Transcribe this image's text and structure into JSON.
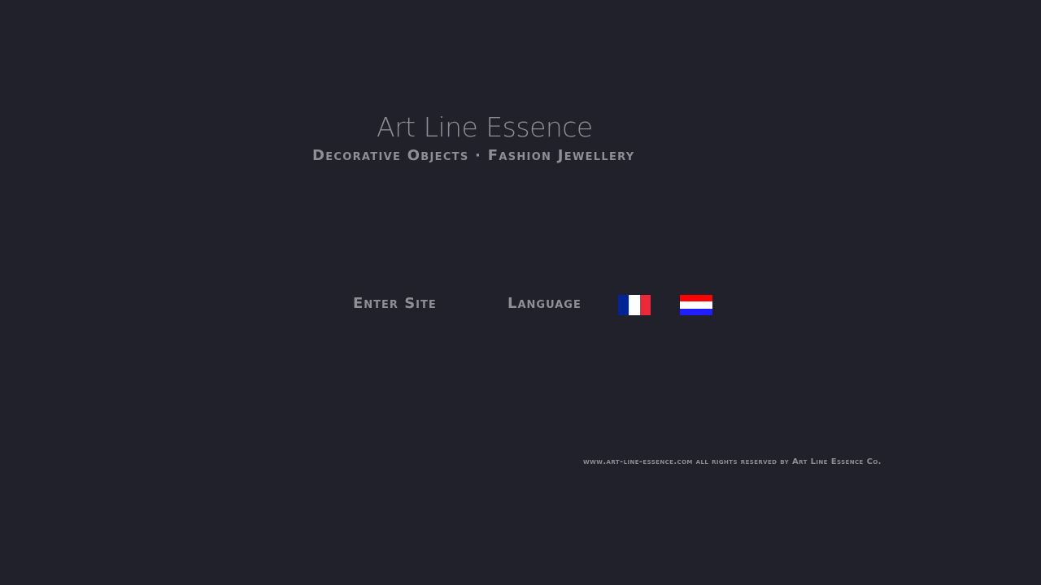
{
  "brand": {
    "title": "Art Line Essence",
    "tagline": "Decorative Objects · Fashion Jewellery"
  },
  "nav": {
    "enter_site": "Enter Site",
    "language_label": "Language"
  },
  "languages": [
    {
      "icon": "flag-france-icon",
      "colors": [
        "#002395",
        "#ffffff",
        "#ed2939"
      ]
    },
    {
      "icon": "flag-netherlands-icon",
      "colors": [
        "#ff0000",
        "#ffffff",
        "#1f1fff"
      ]
    }
  ],
  "footer": {
    "text": "www.art-line-essence.com all rights reserved by Art Line Essence Co."
  },
  "colors": {
    "background": "#21212b",
    "text": "#8f8f95"
  }
}
